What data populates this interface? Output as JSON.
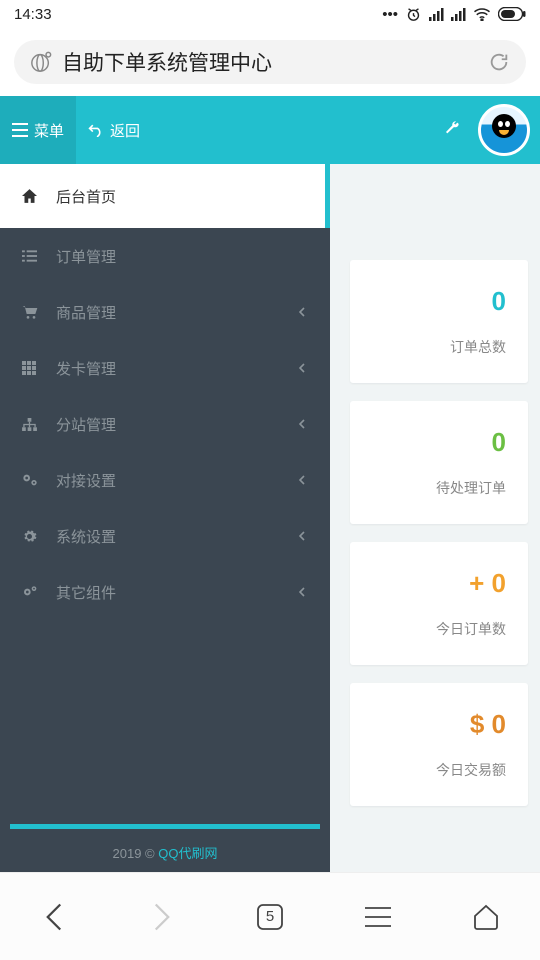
{
  "status": {
    "time": "14:33"
  },
  "browser": {
    "title": "自助下单系统管理中心",
    "tab_count": "5"
  },
  "header": {
    "menu_label": "菜单",
    "back_label": "返回"
  },
  "sidebar": {
    "items": [
      {
        "label": "后台首页"
      },
      {
        "label": "订单管理"
      },
      {
        "label": "商品管理"
      },
      {
        "label": "发卡管理"
      },
      {
        "label": "分站管理"
      },
      {
        "label": "对接设置"
      },
      {
        "label": "系统设置"
      },
      {
        "label": "其它组件"
      }
    ],
    "footer_year": "2019 © ",
    "footer_link": "QQ代刷网"
  },
  "cards": [
    {
      "value": "0",
      "label": "订单总数"
    },
    {
      "value": "0",
      "label": "待处理订单"
    },
    {
      "value": "+ 0",
      "label": "今日订单数"
    },
    {
      "value": "$ 0",
      "label": "今日交易额"
    }
  ]
}
